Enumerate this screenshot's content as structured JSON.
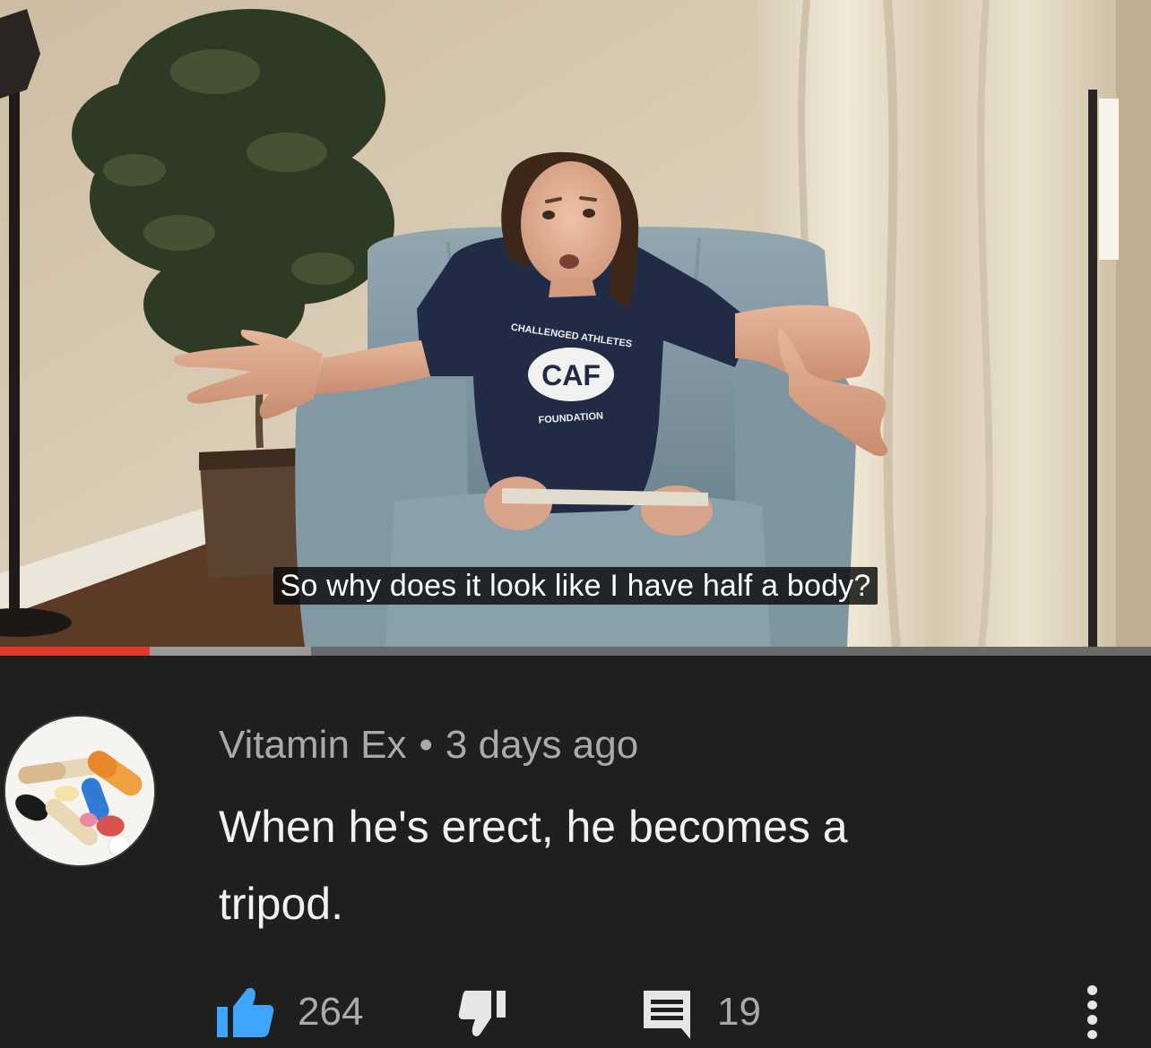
{
  "video": {
    "caption": "So why does it look like I have half a body?",
    "shirt_logo": {
      "top_text": "CHALLENGED ATHLETES",
      "center_text": "CAF",
      "bottom_text": "FOUNDATION"
    },
    "progress_fraction": 0.13,
    "buffer_fraction": 0.27,
    "colors": {
      "progress": "#e03a2f",
      "buffer": "#9a9a9a",
      "track": "#6a6a6a"
    }
  },
  "comment": {
    "author": "Vitamin Ex",
    "separator": "•",
    "time": "3 days ago",
    "text_line1": "When he's erect, he becomes a",
    "text_line2": "tripod.",
    "avatar_icon": "pills-avatar-icon",
    "actions": {
      "like_icon": "thumbs-up-icon",
      "like_count": "264",
      "dislike_icon": "thumbs-down-icon",
      "reply_icon": "comment-icon",
      "reply_count": "19",
      "more_icon": "more-vertical-icon"
    },
    "colors": {
      "background": "#1f1f1f",
      "meta": "#aaaaaa",
      "text": "#f1f1f1",
      "like_active": "#3ea6ff"
    }
  }
}
